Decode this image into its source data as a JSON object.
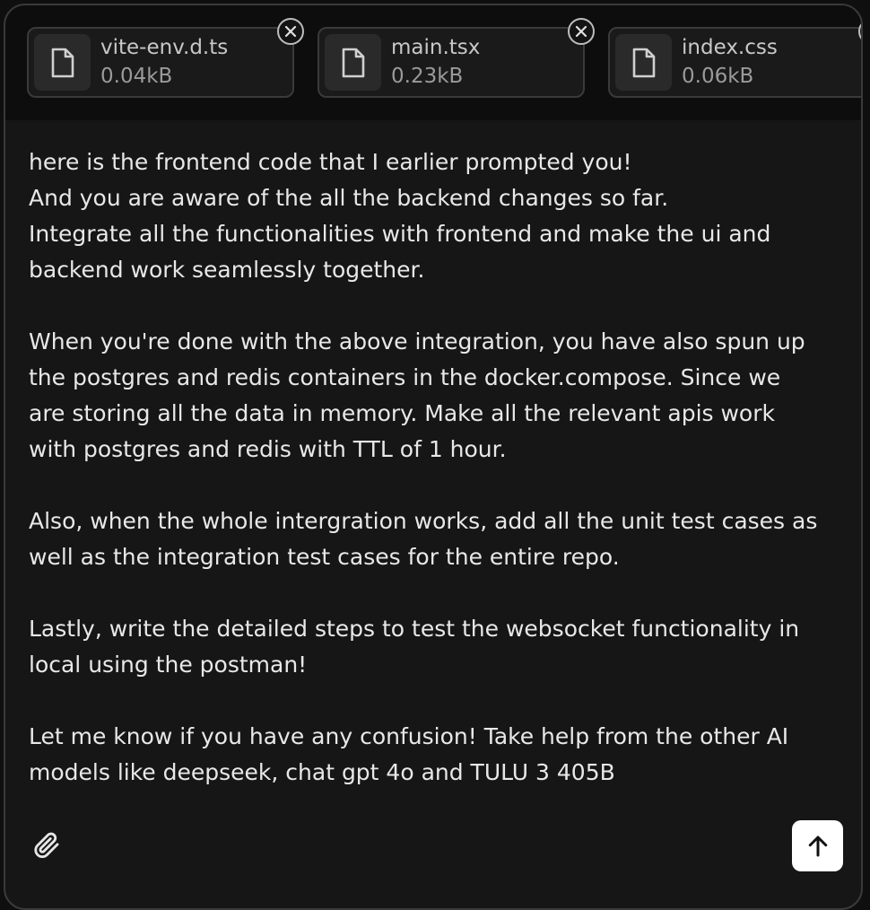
{
  "attachments": [
    {
      "name": "vite-env.d.ts",
      "size": "0.04kB",
      "icon": "file-icon"
    },
    {
      "name": "main.tsx",
      "size": "0.23kB",
      "icon": "file-icon"
    },
    {
      "name": "index.css",
      "size": "0.06kB",
      "icon": "file-icon"
    }
  ],
  "message": "here is the frontend code that I earlier prompted you!\nAnd you are aware of the all the backend changes so far.\nIntegrate all the functionalities with frontend and make the ui and\nbackend work seamlessly together.\n\nWhen you're done with the above integration, you have also spun up\nthe postgres and redis containers in the docker.compose. Since we\nare storing all the data in memory. Make all the relevant apis work\nwith postgres and redis with TTL of 1 hour.\n\nAlso, when the whole intergration works, add all the unit test cases as\nwell as the integration test cases for the entire repo.\n\nLastly, write the detailed steps to test the websocket functionality in\nlocal using the postman!\n\nLet me know if you have any confusion! Take help from the other AI\nmodels like deepseek, chat gpt 4o and TULU 3 405B",
  "icons": {
    "attach": "paperclip-icon",
    "send": "arrow-up-icon",
    "remove": "close-icon"
  },
  "colors": {
    "background": "#161616",
    "text": "#e8e8e8",
    "send_button": "#ffffff"
  }
}
